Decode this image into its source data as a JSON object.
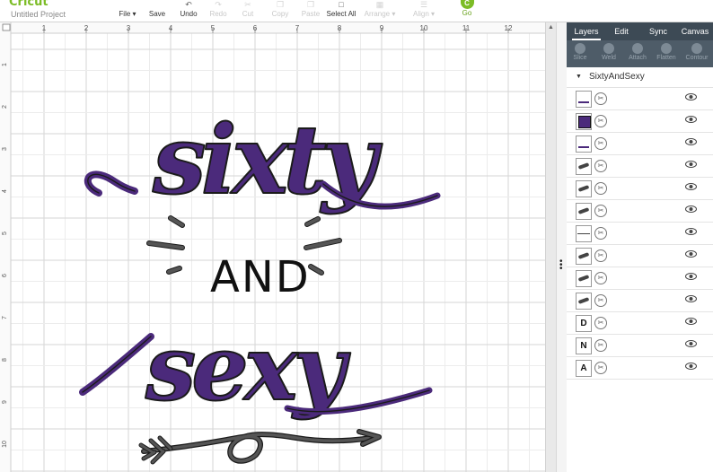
{
  "app": {
    "brand": "Cricut",
    "project_name": "Untitled Project"
  },
  "toolbar": {
    "file": "File ▾",
    "save": "Save",
    "undo": "Undo",
    "redo": "Redo",
    "cut": "Cut",
    "copy": "Copy",
    "paste": "Paste",
    "select_all": "Select All",
    "arrange": "Arrange ▾",
    "align": "Align ▾",
    "go": "Go",
    "go_badge": "C"
  },
  "ruler": {
    "top": [
      "1",
      "2",
      "3",
      "4",
      "5",
      "6",
      "7",
      "8",
      "9",
      "10",
      "11",
      "12"
    ],
    "left": [
      "1",
      "2",
      "3",
      "4",
      "5",
      "6",
      "7",
      "8",
      "9",
      "10"
    ]
  },
  "design": {
    "line1": "sixty",
    "line2": "AND",
    "line3": "sexy",
    "colors": {
      "purple": "#4b2a7b",
      "outline": "#1b1b1b",
      "gray": "#555555"
    }
  },
  "panel": {
    "tabs": [
      "Layers",
      "Edit",
      "Sync",
      "Canvas"
    ],
    "tools": [
      "Slice",
      "Weld",
      "Attach",
      "Flatten",
      "Contour"
    ],
    "group_name": "SixtyAndSexy",
    "layers": [
      {
        "thumb": "sixty"
      },
      {
        "thumb": "square"
      },
      {
        "thumb": "sexy"
      },
      {
        "thumb": "stroke"
      },
      {
        "thumb": "stroke"
      },
      {
        "thumb": "stroke"
      },
      {
        "thumb": "arrow"
      },
      {
        "thumb": "stroke"
      },
      {
        "thumb": "stroke"
      },
      {
        "thumb": "stroke"
      },
      {
        "thumb": "D"
      },
      {
        "thumb": "N"
      },
      {
        "thumb": "A"
      }
    ]
  },
  "colors": {
    "accent": "#7cbc26",
    "panel_dark": "#3d4a55",
    "tool_bar": "#4e5c68"
  }
}
